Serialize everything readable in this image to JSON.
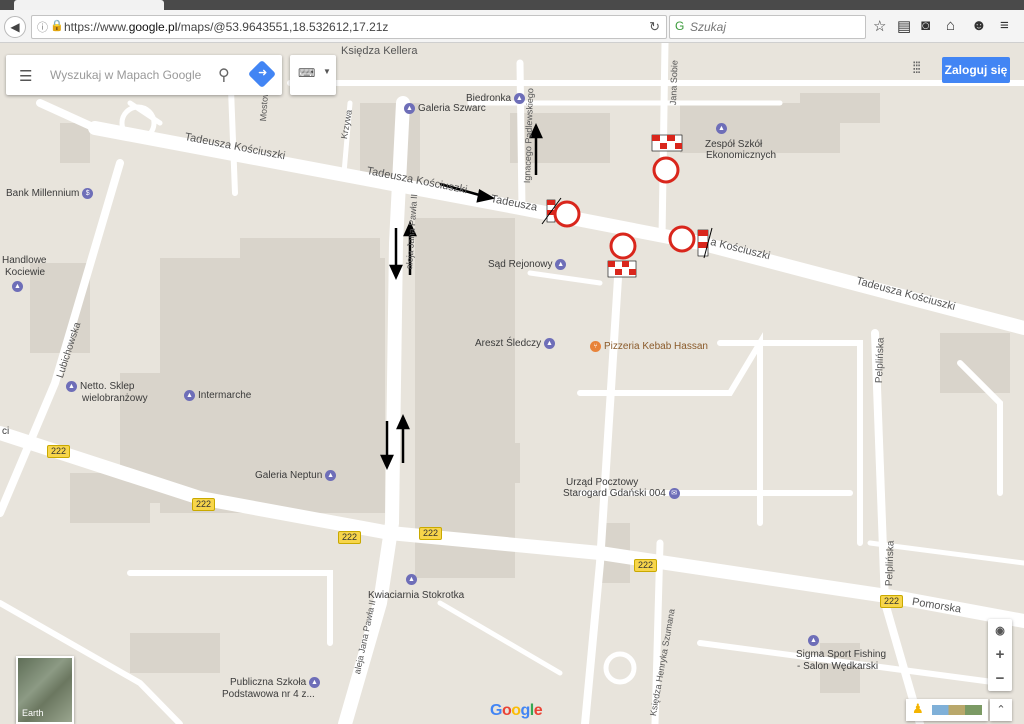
{
  "browser": {
    "url_prefix": "https://www.",
    "url_host": "google.pl",
    "url_rest": "/maps/@53.9643551,18.532612,17.21z",
    "search_placeholder": "Szukaj"
  },
  "maps": {
    "search_placeholder": "Wyszukaj w Mapach Google",
    "sign_in": "Zaloguj się",
    "earth_label": "Earth",
    "logo": "Google",
    "zoom_in": "+",
    "zoom_out": "−"
  },
  "streets": {
    "kellera": "Księdza Kellera",
    "kosciuszki_w": "Tadeusza Kościuszki",
    "kosciuszki_c": "Tadeusza Kościuszki",
    "kosciuszki_c2": "Tadeusza",
    "kosciuszki_e": "a Kościuszki",
    "kosciuszki_far": "Tadeusza Kościuszki",
    "jana_pawla": "aleja Jana Pawła II",
    "jana_pawla_s": "aleja Jana Pawła II",
    "padlewskiego": "Ignacego Padlewskiego",
    "sobieskiego": "Jana Sobie",
    "lubichowska": "Lubichowska",
    "pelplinska": "Pelplińska",
    "pelplinska_s": "Pelplińska",
    "pomorska": "Pomorska",
    "szumana": "Księdza Henryka Szumana",
    "krzywa": "Krzywa",
    "mostowa": "Mostowa"
  },
  "routes": [
    "222",
    "222",
    "222",
    "222",
    "222",
    "222"
  ],
  "places": {
    "bank": "Bank Millennium",
    "handlowe": "Handlowe",
    "kociewie": "Kociewie",
    "netto": "Netto. Sklep",
    "netto2": "wielobranżowy",
    "intermarche": "Intermarche",
    "galeria_neptun": "Galeria Neptun",
    "galeria_szwarc": "Galeria Szwarc",
    "biedronka": "Biedronka",
    "sad": "Sąd Rejonowy",
    "areszt": "Areszt Śledczy",
    "pizzeria": "Pizzeria Kebab Hassan",
    "urzad": "Urząd Pocztowy",
    "urzad2": "Starogard Gdański 004",
    "kwiaciarnia": "Kwiaciarnia Stokrotka",
    "szkola": "Publiczna Szkoła",
    "szkola2": "Podstawowa nr 4 z...",
    "zespol": "Zespół Szkół",
    "zespol2": "Ekonomicznych",
    "sigma": "Sigma Sport Fishing",
    "sigma2": "- Salon Wędkarski",
    "ci": "ci"
  },
  "icons": [
    "back-icon",
    "info-icon",
    "lock-icon",
    "reload-icon",
    "search-icon",
    "star-icon",
    "clipboard-icon",
    "pocket-icon",
    "home-icon",
    "smile-icon",
    "hamburger-icon",
    "keyboard-icon",
    "apps-grid-icon",
    "locate-icon",
    "pegman-icon",
    "expand-icon"
  ],
  "colors": {
    "map_bg": "#e8e4dc",
    "road": "#ffffff",
    "block": "#d9d4cb",
    "signal_red": "#d9261c",
    "accent_blue": "#4285f4"
  }
}
